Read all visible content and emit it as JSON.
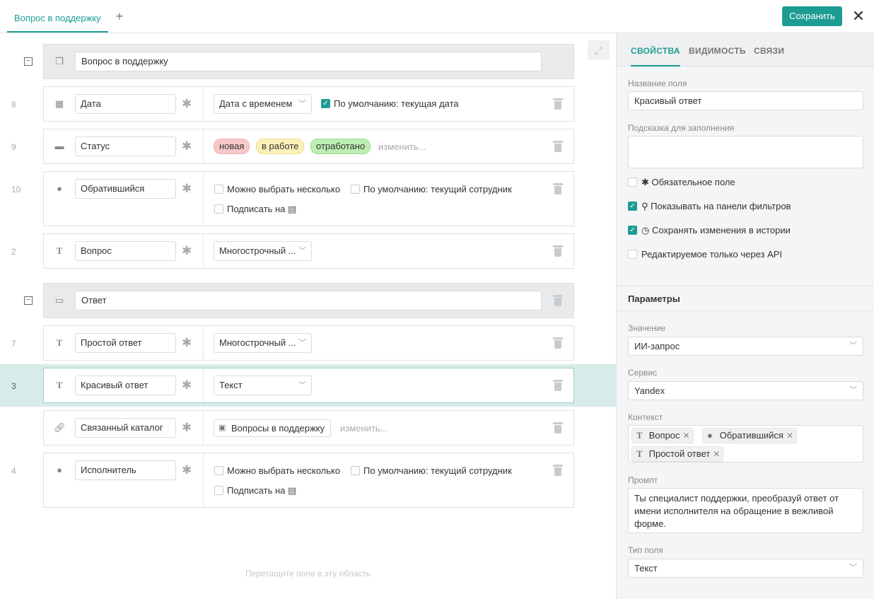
{
  "header": {
    "tab_label": "Вопрос в поддержку",
    "add_tab": "+",
    "save_label": "Сохранить",
    "close_label": "✕"
  },
  "canvas": {
    "section1": {
      "title": "Вопрос в поддержку"
    },
    "rows": [
      {
        "num": "8",
        "name": "Дата",
        "type": "Дата с временем",
        "checkbox_label": "По умолчанию: текущая дата"
      },
      {
        "num": "9",
        "name": "Статус",
        "statuses": [
          "новая",
          "в работе",
          "отработано"
        ],
        "change_link": "изменить..."
      },
      {
        "num": "10",
        "name": "Обратившийся",
        "opt_multi": "Можно выбрать несколько",
        "opt_default": "По умолчанию: текущий сотрудник",
        "opt_subscribe": "Подписать на"
      },
      {
        "num": "2",
        "name": "Вопрос",
        "type": "Многострочный ..."
      }
    ],
    "section2": {
      "title": "Ответ"
    },
    "rows2": [
      {
        "num": "7",
        "name": "Простой ответ",
        "type": "Многострочный ..."
      },
      {
        "num": "3",
        "name": "Красивый ответ",
        "type": "Текст"
      },
      {
        "num": "",
        "name": "Связанный каталог",
        "catalog": "Вопросы в поддержку",
        "change_link": "изменить..."
      },
      {
        "num": "4",
        "name": "Исполнитель",
        "opt_multi": "Можно выбрать несколько",
        "opt_default": "По умолчанию: текущий сотрудник",
        "opt_subscribe": "Подписать на"
      }
    ],
    "dropzone": "Перетащите поле в эту область"
  },
  "panel": {
    "tabs": [
      "СВОЙСТВА",
      "ВИДИМОСТЬ",
      "СВЯЗИ"
    ],
    "field_name_label": "Название поля",
    "field_name_value": "Красивый ответ",
    "hint_label": "Подсказка для заполнения",
    "hint_value": "",
    "options": [
      {
        "label": "✱ Обязательное поле",
        "checked": false
      },
      {
        "label": "⚲ Показывать на панели фильтров",
        "checked": true
      },
      {
        "label": "◷ Сохранять изменения в истории",
        "checked": true
      },
      {
        "label": "Редактируемое только через API",
        "checked": false
      }
    ],
    "params_title": "Параметры",
    "value_label": "Значение",
    "value_value": "ИИ-запрос",
    "service_label": "Сервис",
    "service_value": "Yandex",
    "context_label": "Контекст",
    "context_tags": [
      "Вопрос",
      "Обратившийся",
      "Простой ответ"
    ],
    "prompt_label": "Промпт",
    "prompt_value": "Ты специалист поддержки, преобразуй ответ от имени исполнителя на обращение в вежливой форме.",
    "field_type_label": "Тип поля",
    "field_type_value": "Текст"
  },
  "colors": {
    "accent": "#1e9c93",
    "status_new": "#f7c9c9",
    "status_work": "#fbf0b8",
    "status_done": "#bdeeb3"
  }
}
